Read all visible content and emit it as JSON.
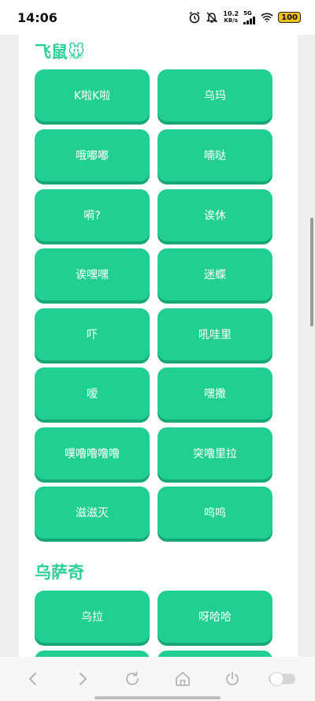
{
  "status_bar": {
    "time": "14:06",
    "net_speed_value": "10.2",
    "net_speed_unit": "KB/s",
    "network_type": "5G",
    "battery": "100"
  },
  "sections": [
    {
      "title": "飞鼠🐭",
      "buttons": [
        "K啦K啦",
        "乌玛",
        "哦嘟嘟",
        "喃哒",
        "嗬?",
        "诶休",
        "诶嘿嘿",
        "迷蝶",
        "吓",
        "吼哇里",
        "嗳",
        "嘿撒",
        "噗噜噜噜噜",
        "突噜里拉",
        "滋滋灭",
        "呜呜"
      ]
    },
    {
      "title": "乌萨奇",
      "buttons": [
        "乌拉",
        "呀哈哈",
        "",
        ""
      ]
    }
  ],
  "nav": {
    "back": "back-icon",
    "forward": "forward-icon",
    "refresh": "refresh-icon",
    "home": "home-icon",
    "power": "power-icon",
    "toggle": "toggle-icon"
  },
  "colors": {
    "accent": "#22cf93",
    "accent_shadow": "#17a874",
    "title": "#2fcf95"
  }
}
